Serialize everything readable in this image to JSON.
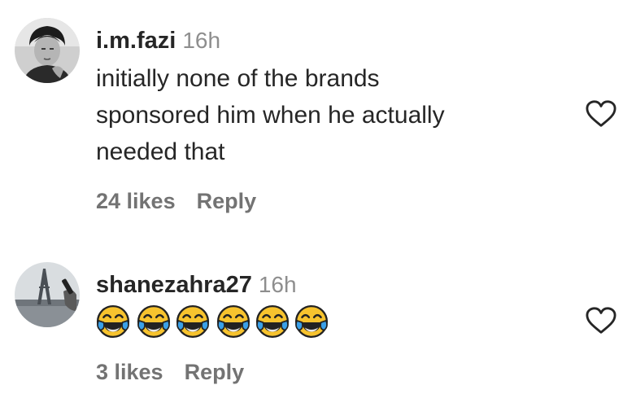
{
  "comments": [
    {
      "username": "i.m.fazi",
      "time": "16h",
      "text_lines": [
        "initially none of the brands",
        "sponsored him when he actually",
        "needed that"
      ],
      "likes": "24 likes",
      "reply": "Reply",
      "avatar_icon": "profile-photo-man",
      "like_icon": "heart-outline-icon"
    },
    {
      "username": "shanezahra27",
      "time": "16h",
      "emoji": [
        "😂",
        "😂",
        "😂",
        "😂",
        "😂",
        "😂"
      ],
      "emoji_icon": "face-with-tears-of-joy-icon",
      "likes": "3 likes",
      "reply": "Reply",
      "avatar_icon": "profile-photo-eiffel-tower",
      "like_icon": "heart-outline-icon"
    }
  ],
  "colors": {
    "username": "#262626",
    "secondary": "#8e8e8e",
    "meta": "#737373",
    "emoji_face": "#f7c32e",
    "emoji_tear": "#3aa0e8"
  }
}
